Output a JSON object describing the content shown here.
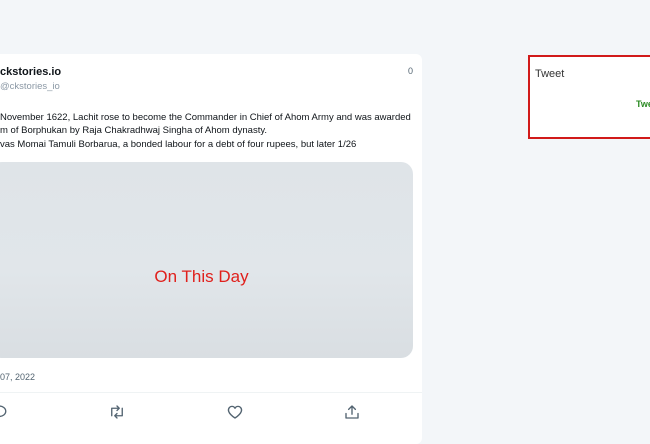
{
  "tweet": {
    "display_name": "ckstories.io",
    "handle": "@ckstories_io",
    "count": "0",
    "lines": [
      "November 1622, Lachit rose to become the Commander in Chief of Ahom Army and was awarded",
      "m of Borphukan by Raja Chakradhwaj Singha of Ahom dynasty.",
      "vas Momai Tamuli Borbarua, a bonded labour for a debt of four rupees, but later 1/26"
    ],
    "media_title": "On This Day",
    "date": "07, 2022",
    "actions": [
      {
        "icon": "reply-icon"
      },
      {
        "icon": "retweet-icon"
      },
      {
        "icon": "like-icon"
      },
      {
        "icon": "share-icon"
      }
    ]
  },
  "compose": {
    "label": "Tweet",
    "button": "Twe"
  },
  "colors": {
    "background": "#f3f6f9",
    "accent_red": "#d11a1a",
    "button_green": "#2a8a22",
    "media_title": "#e0201c"
  }
}
